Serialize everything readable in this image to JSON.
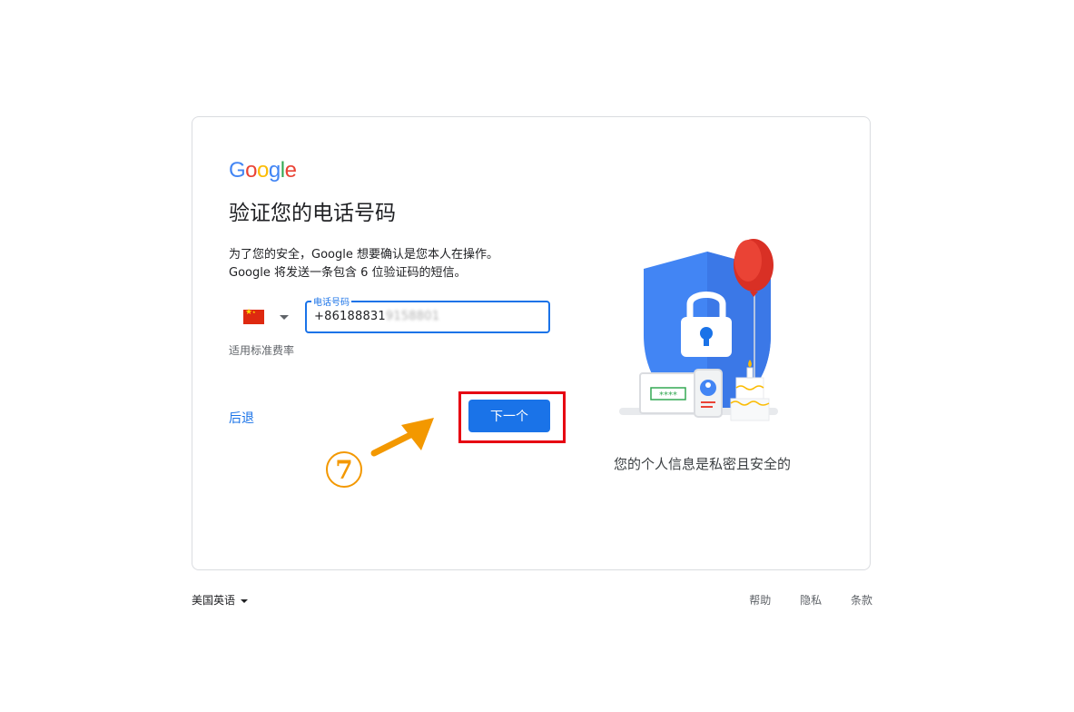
{
  "logo": {
    "letters": [
      "G",
      "o",
      "o",
      "g",
      "l",
      "e"
    ],
    "colors": [
      "#4285F4",
      "#EA4335",
      "#FBBC05",
      "#4285F4",
      "#34A853",
      "#EA4335"
    ]
  },
  "title": "验证您的电话号码",
  "description": {
    "line1": "为了您的安全，Google 想要确认是您本人在操作。",
    "line2": "Google 将发送一条包含 6 位验证码的短信。"
  },
  "country": {
    "flag": "china-flag"
  },
  "phone": {
    "label": "电话号码",
    "value_visible": "+86188831",
    "value_obscured": "9158801"
  },
  "hint": "适用标准费率",
  "actions": {
    "back_label": "后退",
    "next_label": "下一个"
  },
  "illustration": {
    "caption": "您的个人信息是私密且安全的",
    "password_mask": "****"
  },
  "annotation": {
    "step_number": "7"
  },
  "footer": {
    "language": "美国英语",
    "links": [
      "帮助",
      "隐私",
      "条款"
    ]
  }
}
